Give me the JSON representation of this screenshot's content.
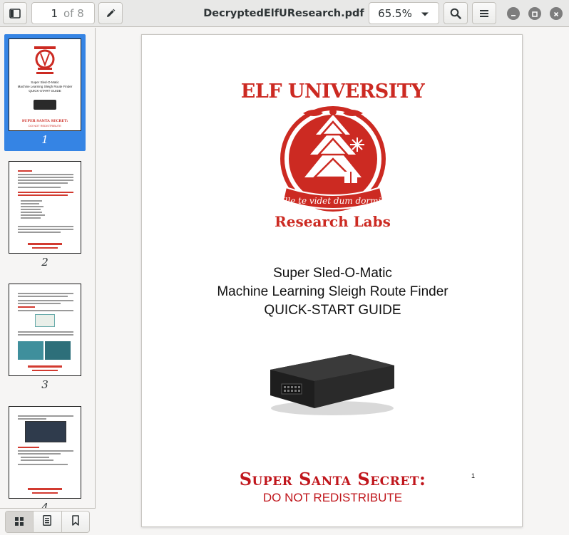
{
  "header": {
    "page_number": "1",
    "page_total": "of 8",
    "document_title": "DecryptedElfUResearch.pdf",
    "zoom": "65.5%"
  },
  "sidebar": {
    "thumbnails": [
      {
        "label": "1",
        "selected": true
      },
      {
        "label": "2",
        "selected": false
      },
      {
        "label": "3",
        "selected": false
      },
      {
        "label": "4",
        "selected": false
      }
    ],
    "thumb1": {
      "line1": "Super Sled-O-Matic",
      "line2": "Machine Learning Sleigh Route Finder",
      "line3": "QUICK-START GUIDE",
      "secret": "SUPER SANTA SECRET:",
      "dnr": "DO NOT REDISTRIBUTE"
    }
  },
  "page": {
    "logo_title": "ELF UNIVERSITY",
    "logo_motto": "Ille te videt dum dormit",
    "logo_subtitle": "Research Labs",
    "line1": "Super Sled-O-Matic",
    "line2": "Machine Learning Sleigh Route Finder",
    "line3": "QUICK-START GUIDE",
    "secret": "Super Santa Secret:",
    "dnr": "DO NOT REDISTRIBUTE",
    "page_number": "1"
  },
  "colors": {
    "accent": "#3584e4",
    "brand_red": "#cc2a22"
  },
  "icons": {
    "sidebar_toggle": "sidebar-toggle-icon",
    "annotate": "pencil-icon",
    "search": "search-icon",
    "menu": "hamburger-menu-icon",
    "minimize": "minimize-icon",
    "maximize": "maximize-icon",
    "close": "close-icon",
    "thumbnails": "grid-icon",
    "outline": "document-outline-icon",
    "bookmarks": "bookmark-icon"
  }
}
